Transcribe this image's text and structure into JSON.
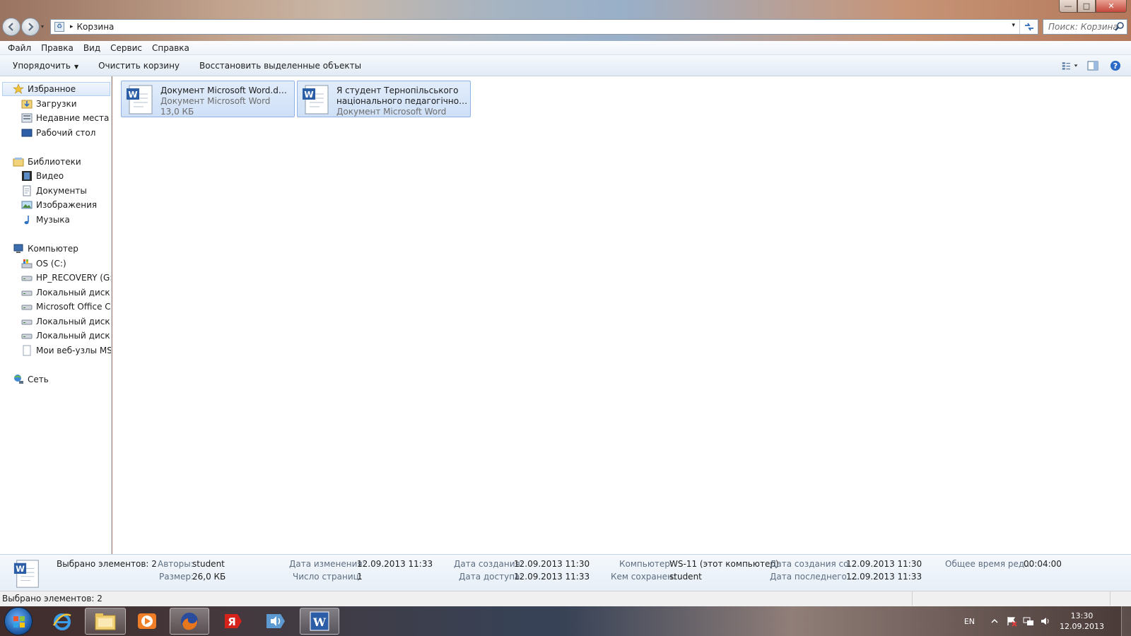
{
  "window": {
    "min_glyph": "—",
    "max_glyph": "□",
    "close_glyph": "✕"
  },
  "address": {
    "path_sep": "▸",
    "location": "Корзина",
    "dropdown_glyph": "▾",
    "search_placeholder": "Поиск: Корзина"
  },
  "menu": [
    "Файл",
    "Правка",
    "Вид",
    "Сервис",
    "Справка"
  ],
  "toolbar": {
    "organize": "Упорядочить",
    "empty_bin": "Очистить корзину",
    "restore": "Восстановить выделенные объекты"
  },
  "nav": {
    "favorites": "Избранное",
    "downloads": "Загрузки",
    "recent": "Недавние места",
    "desktop": "Рабочий стол",
    "libraries": "Библиотеки",
    "video": "Видео",
    "documents": "Документы",
    "pictures": "Изображения",
    "music": "Музыка",
    "computer": "Компьютер",
    "drive_c": "OS (C:)",
    "drive_g": "HP_RECOVERY (G:)",
    "drive_n": "Локальный диск (N",
    "drive_office": "Microsoft Office Clic",
    "drive_r": "Локальный диск (R",
    "drive_s": "Локальный диск (S:",
    "msn": "Мои веб-узлы MSN",
    "network": "Сеть"
  },
  "files": [
    {
      "name": "Документ Microsoft Word.docx",
      "type": "Документ Microsoft Word",
      "size": "13,0 КБ"
    },
    {
      "name": "Я студент Тернопільського",
      "name2": "національного педагогічного у...",
      "type": "Документ Microsoft Word"
    }
  ],
  "details": {
    "selected": "Выбрано элементов: 2",
    "authors_label": "Авторы:",
    "authors": "student",
    "size_label": "Размер:",
    "size": "26,0 КБ",
    "modified_label": "Дата изменения:",
    "modified": "12.09.2013 11:33",
    "pages_label": "Число страниц:",
    "pages": "1",
    "created_label": "Дата создания:",
    "created": "12.09.2013 11:30",
    "accessed_label": "Дата доступа:",
    "accessed": "12.09.2013 11:33",
    "computer_label": "Компьютер:",
    "computer": "WS-11 (этот компьютер)",
    "saved_by_label": "Кем сохранен:",
    "saved_by": "student",
    "content_created_label": "Дата создания со...",
    "content_created": "12.09.2013 11:30",
    "last_saved_label": "Дата последнего ...",
    "last_saved": "12.09.2013 11:33",
    "edit_time_label": "Общее время ред...",
    "edit_time": "00:04:00"
  },
  "status": {
    "text": "Выбрано элементов: 2"
  },
  "taskbar": {
    "lang": "EN",
    "time": "13:30",
    "date": "12.09.2013",
    "yandex_glyph": "Я",
    "word_glyph": "W"
  },
  "colors": {
    "accent": "#3b78c4",
    "selection": "#cfe0f7"
  }
}
